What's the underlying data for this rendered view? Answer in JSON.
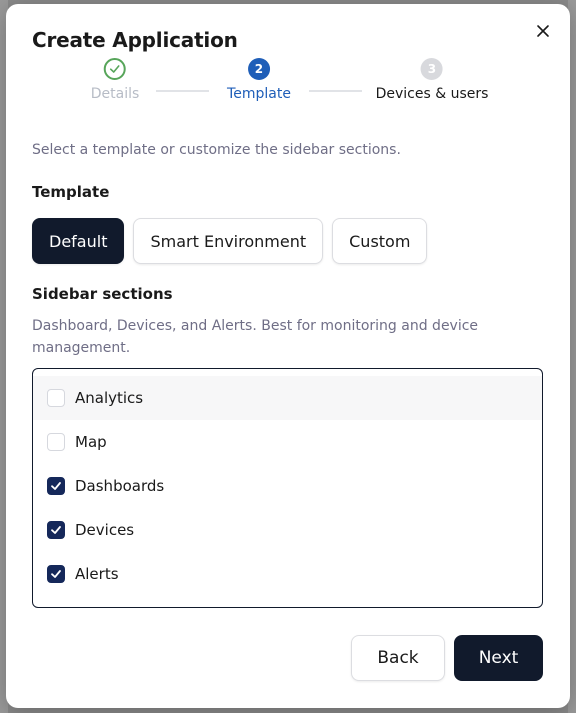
{
  "modal": {
    "title": "Create Application",
    "close_icon": "close-icon"
  },
  "stepper": {
    "steps": [
      {
        "label": "Details",
        "number": "1",
        "state": "done",
        "icon": "check-icon"
      },
      {
        "label": "Template",
        "number": "2",
        "state": "active"
      },
      {
        "label": "Devices & users",
        "number": "3",
        "state": "pending"
      }
    ]
  },
  "hint": "Select a template or customize the sidebar sections.",
  "template": {
    "label": "Template",
    "options": [
      {
        "label": "Default",
        "selected": true
      },
      {
        "label": "Smart Environment",
        "selected": false
      },
      {
        "label": "Custom",
        "selected": false
      }
    ]
  },
  "sidebar": {
    "label": "Sidebar sections",
    "description": "Dashboard, Devices, and Alerts. Best for monitoring and device management.",
    "items": [
      {
        "label": "Analytics",
        "checked": false
      },
      {
        "label": "Map",
        "checked": false
      },
      {
        "label": "Dashboards",
        "checked": true
      },
      {
        "label": "Devices",
        "checked": true
      },
      {
        "label": "Alerts",
        "checked": true
      }
    ]
  },
  "footer": {
    "back_label": "Back",
    "next_label": "Next"
  },
  "colors": {
    "primary_dark": "#111a2c",
    "step_active": "#1f5eb8",
    "step_done": "#57a55a",
    "checkbox_checked": "#15285a"
  }
}
